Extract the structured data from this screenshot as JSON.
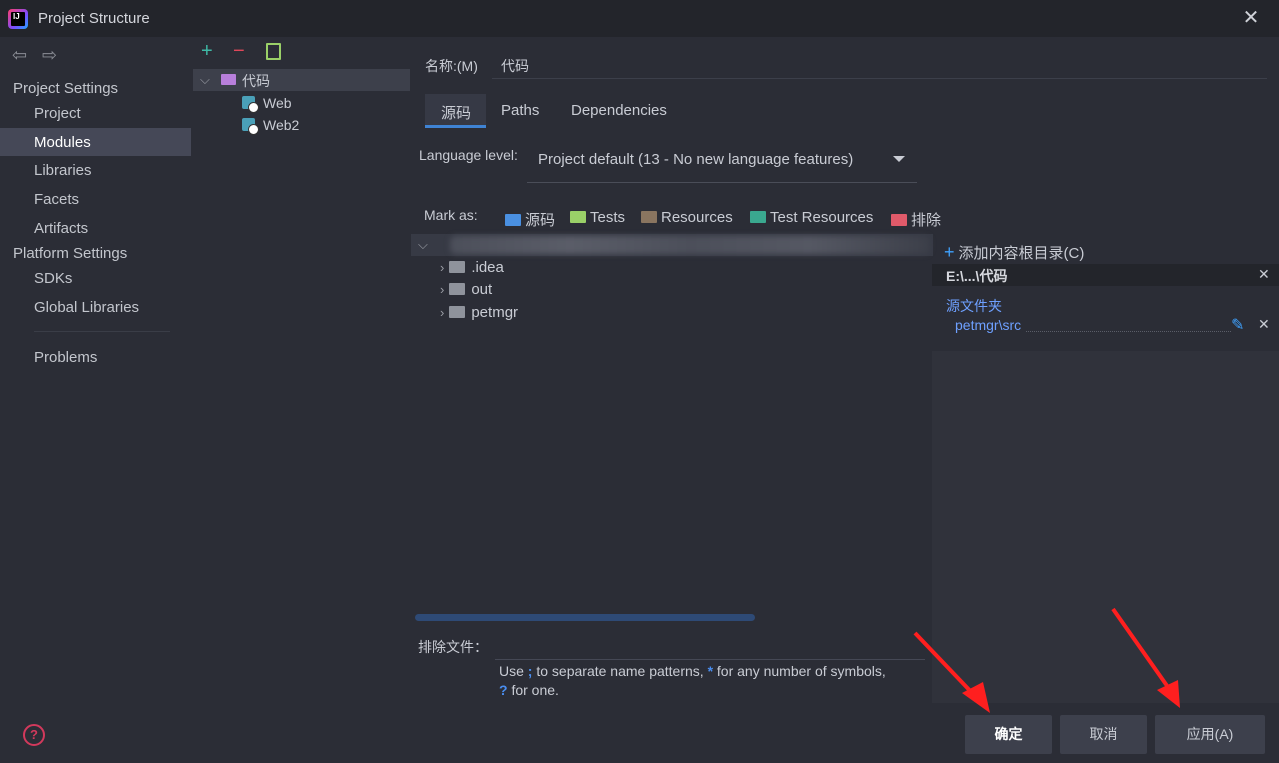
{
  "window": {
    "title": "Project Structure"
  },
  "nav": {
    "project_settings": "Project Settings",
    "project_items": [
      "Project",
      "Modules",
      "Libraries",
      "Facets",
      "Artifacts"
    ],
    "platform_settings": "Platform Settings",
    "platform_items": [
      "SDKs",
      "Global Libraries"
    ],
    "problems": "Problems",
    "selected": "Modules"
  },
  "modules": {
    "root": "代码",
    "children": [
      "Web",
      "Web2"
    ]
  },
  "module": {
    "name_label": "名称:(M)",
    "name_value": "代码",
    "tabs": [
      "源码",
      "Paths",
      "Dependencies"
    ],
    "active_tab": "源码",
    "language_label": "Language level:",
    "language_value": "Project default (13 - No new language features)",
    "mark_as_label": "Mark as:",
    "mark_as": [
      {
        "label": "源码",
        "color": "#4a90e2"
      },
      {
        "label": "Tests",
        "color": "#9ad068"
      },
      {
        "label": "Resources",
        "color": "#8a7560"
      },
      {
        "label": "Test Resources",
        "color": "#3aa88f"
      },
      {
        "label": "排除",
        "color": "#e05a6a"
      }
    ]
  },
  "file_tree": {
    "folders": [
      ".idea",
      "out",
      "petmgr"
    ]
  },
  "exclude": {
    "label": "排除文件：",
    "hint_use": "Use",
    "hint_sep": ";",
    "hint_mid": "to separate name patterns,",
    "hint_star": "*",
    "hint_any": "for any number of symbols,",
    "hint_q": "?",
    "hint_one": "for one."
  },
  "content_root": {
    "add_label": "添加内容根目录(C)",
    "path": "E:\\...\\代码",
    "source_folders_title": "源文件夹",
    "source_folder": "petmgr\\src"
  },
  "buttons": {
    "ok": "确定",
    "cancel": "取消",
    "apply": "应用(A)"
  }
}
